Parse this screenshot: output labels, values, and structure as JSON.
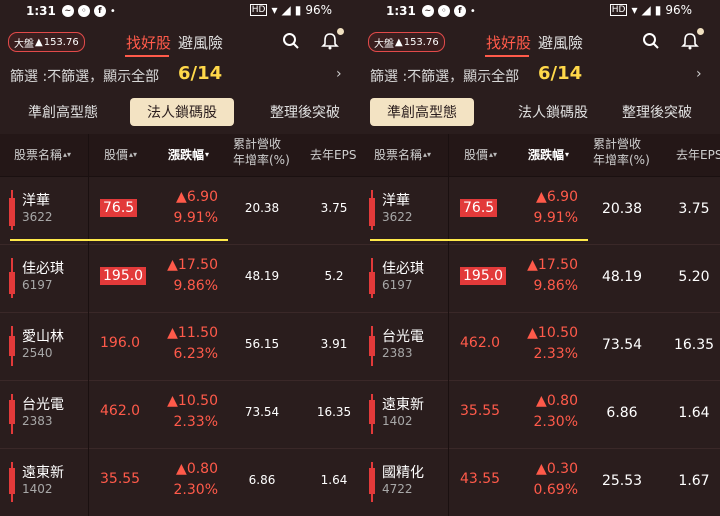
{
  "status": {
    "time": "1:31",
    "battery": "96%"
  },
  "header": {
    "market_label": "大盤",
    "market_change": "153.76",
    "tab_find": "找好股",
    "tab_avoid": "避風險"
  },
  "filter": {
    "text": "篩選 :不篩選，顯示全部",
    "count": "6/14"
  },
  "subtabs": [
    "準創高型態",
    "法人鎖碼股",
    "整理後突破"
  ],
  "table_headers": {
    "name": "股票名稱",
    "price": "股價",
    "change": "漲跌幅",
    "revenue_l1": "累計營收",
    "revenue_l2": "年增率(%)",
    "eps": "去年EPS"
  },
  "panels": [
    {
      "selected_subtab": 1,
      "rows": [
        {
          "name": "洋華",
          "code": "3622",
          "price": "76.5",
          "price_boxed": true,
          "change": "▲6.90",
          "pct": "9.91%",
          "revenue": "20.38",
          "eps": "3.75"
        },
        {
          "name": "佳必琪",
          "code": "6197",
          "price": "195.0",
          "price_boxed": true,
          "change": "▲17.50",
          "pct": "9.86%",
          "revenue": "48.19",
          "eps": "5.2"
        },
        {
          "name": "愛山林",
          "code": "2540",
          "price": "196.0",
          "price_boxed": false,
          "change": "▲11.50",
          "pct": "6.23%",
          "revenue": "56.15",
          "eps": "3.91"
        },
        {
          "name": "台光電",
          "code": "2383",
          "price": "462.0",
          "price_boxed": false,
          "change": "▲10.50",
          "pct": "2.33%",
          "revenue": "73.54",
          "eps": "16.35"
        },
        {
          "name": "遠東新",
          "code": "1402",
          "price": "35.55",
          "price_boxed": false,
          "change": "▲0.80",
          "pct": "2.30%",
          "revenue": "6.86",
          "eps": "1.64"
        }
      ]
    },
    {
      "selected_subtab": 0,
      "rows": [
        {
          "name": "洋華",
          "code": "3622",
          "price": "76.5",
          "price_boxed": true,
          "change": "▲6.90",
          "pct": "9.91%",
          "revenue": "20.38",
          "eps": "3.75"
        },
        {
          "name": "佳必琪",
          "code": "6197",
          "price": "195.0",
          "price_boxed": true,
          "change": "▲17.50",
          "pct": "9.86%",
          "revenue": "48.19",
          "eps": "5.20"
        },
        {
          "name": "台光電",
          "code": "2383",
          "price": "462.0",
          "price_boxed": false,
          "change": "▲10.50",
          "pct": "2.33%",
          "revenue": "73.54",
          "eps": "16.35"
        },
        {
          "name": "遠東新",
          "code": "1402",
          "price": "35.55",
          "price_boxed": false,
          "change": "▲0.80",
          "pct": "2.30%",
          "revenue": "6.86",
          "eps": "1.64"
        },
        {
          "name": "國精化",
          "code": "4722",
          "price": "43.55",
          "price_boxed": false,
          "change": "▲0.30",
          "pct": "0.69%",
          "revenue": "25.53",
          "eps": "1.67"
        }
      ]
    }
  ],
  "colors": {
    "accent_red": "#ff5a4a",
    "highlight_yellow": "#ffd84a",
    "selected_tab_bg": "#f3e3c3"
  }
}
